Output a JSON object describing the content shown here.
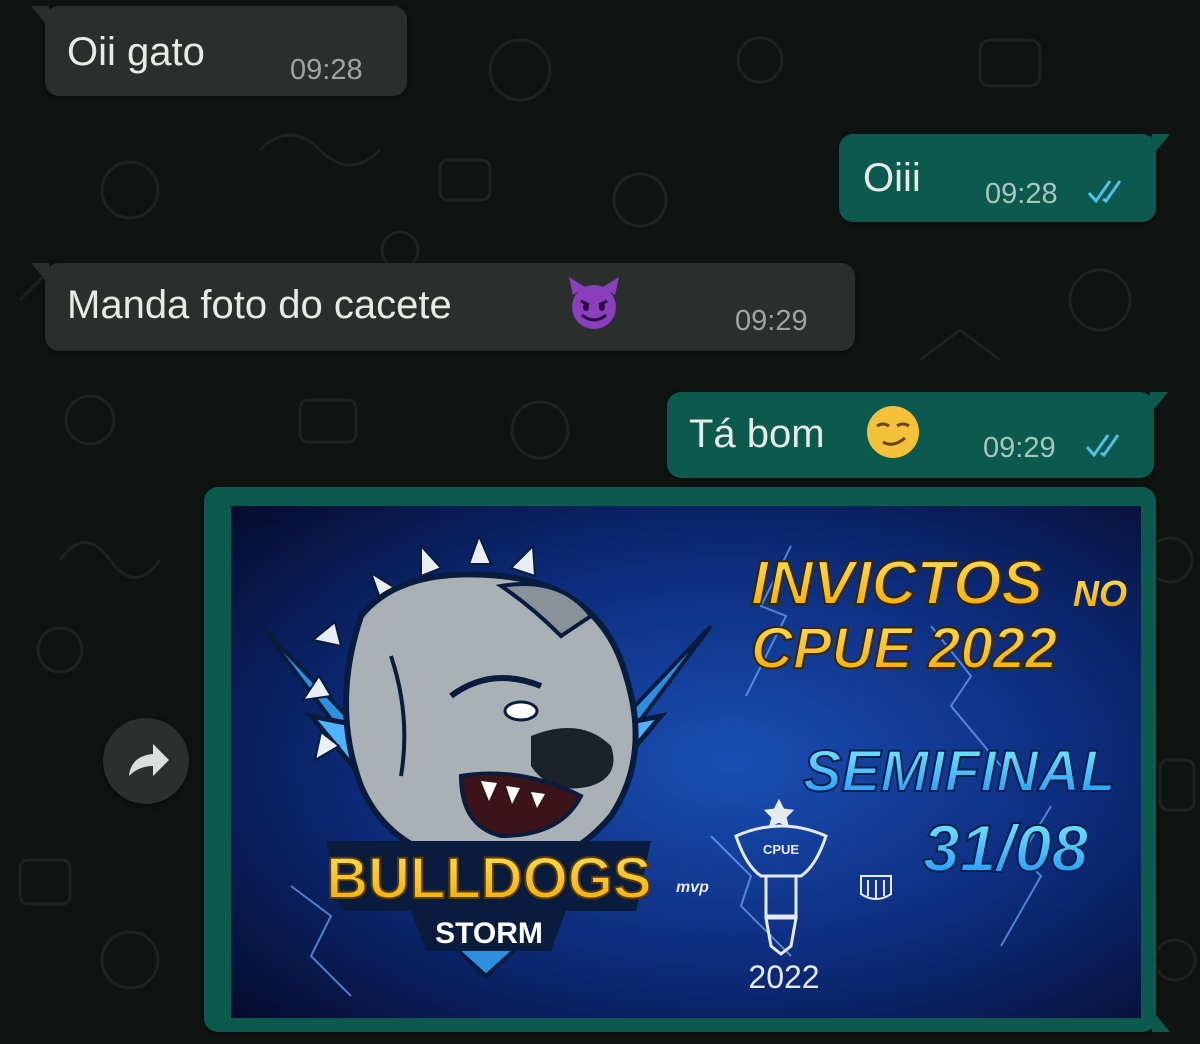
{
  "messages": [
    {
      "direction": "incoming",
      "text": "Oii gato",
      "time": "09:28"
    },
    {
      "direction": "outgoing",
      "text": "Oiii",
      "time": "09:28",
      "status": "read"
    },
    {
      "direction": "incoming",
      "text": "Manda foto do cacete",
      "emoji": "smiling-imp",
      "time": "09:29"
    },
    {
      "direction": "outgoing",
      "text": "Tá bom",
      "emoji": "smirking-face",
      "time": "09:29",
      "status": "read"
    }
  ],
  "image_message": {
    "direction": "outgoing",
    "forward_icon": "share-arrow-icon",
    "poster": {
      "team_name": "BULLDOGS",
      "team_sub": "STORM",
      "headline_1": "INVICTOS",
      "headline_1_suffix": "NO",
      "headline_2": "CPUE 2022",
      "stage": "SEMIFINAL",
      "date": "31/08",
      "badge_text": "CPUE",
      "badge_year": "2022",
      "mvp": "mvp"
    }
  },
  "colors": {
    "incoming_bubble": "#2a2f2d",
    "outgoing_bubble": "#0c5a4e",
    "read_ticks": "#53bdeb",
    "headline_yellow": "#f4c21a",
    "stage_cyan": "#35d2ff"
  }
}
